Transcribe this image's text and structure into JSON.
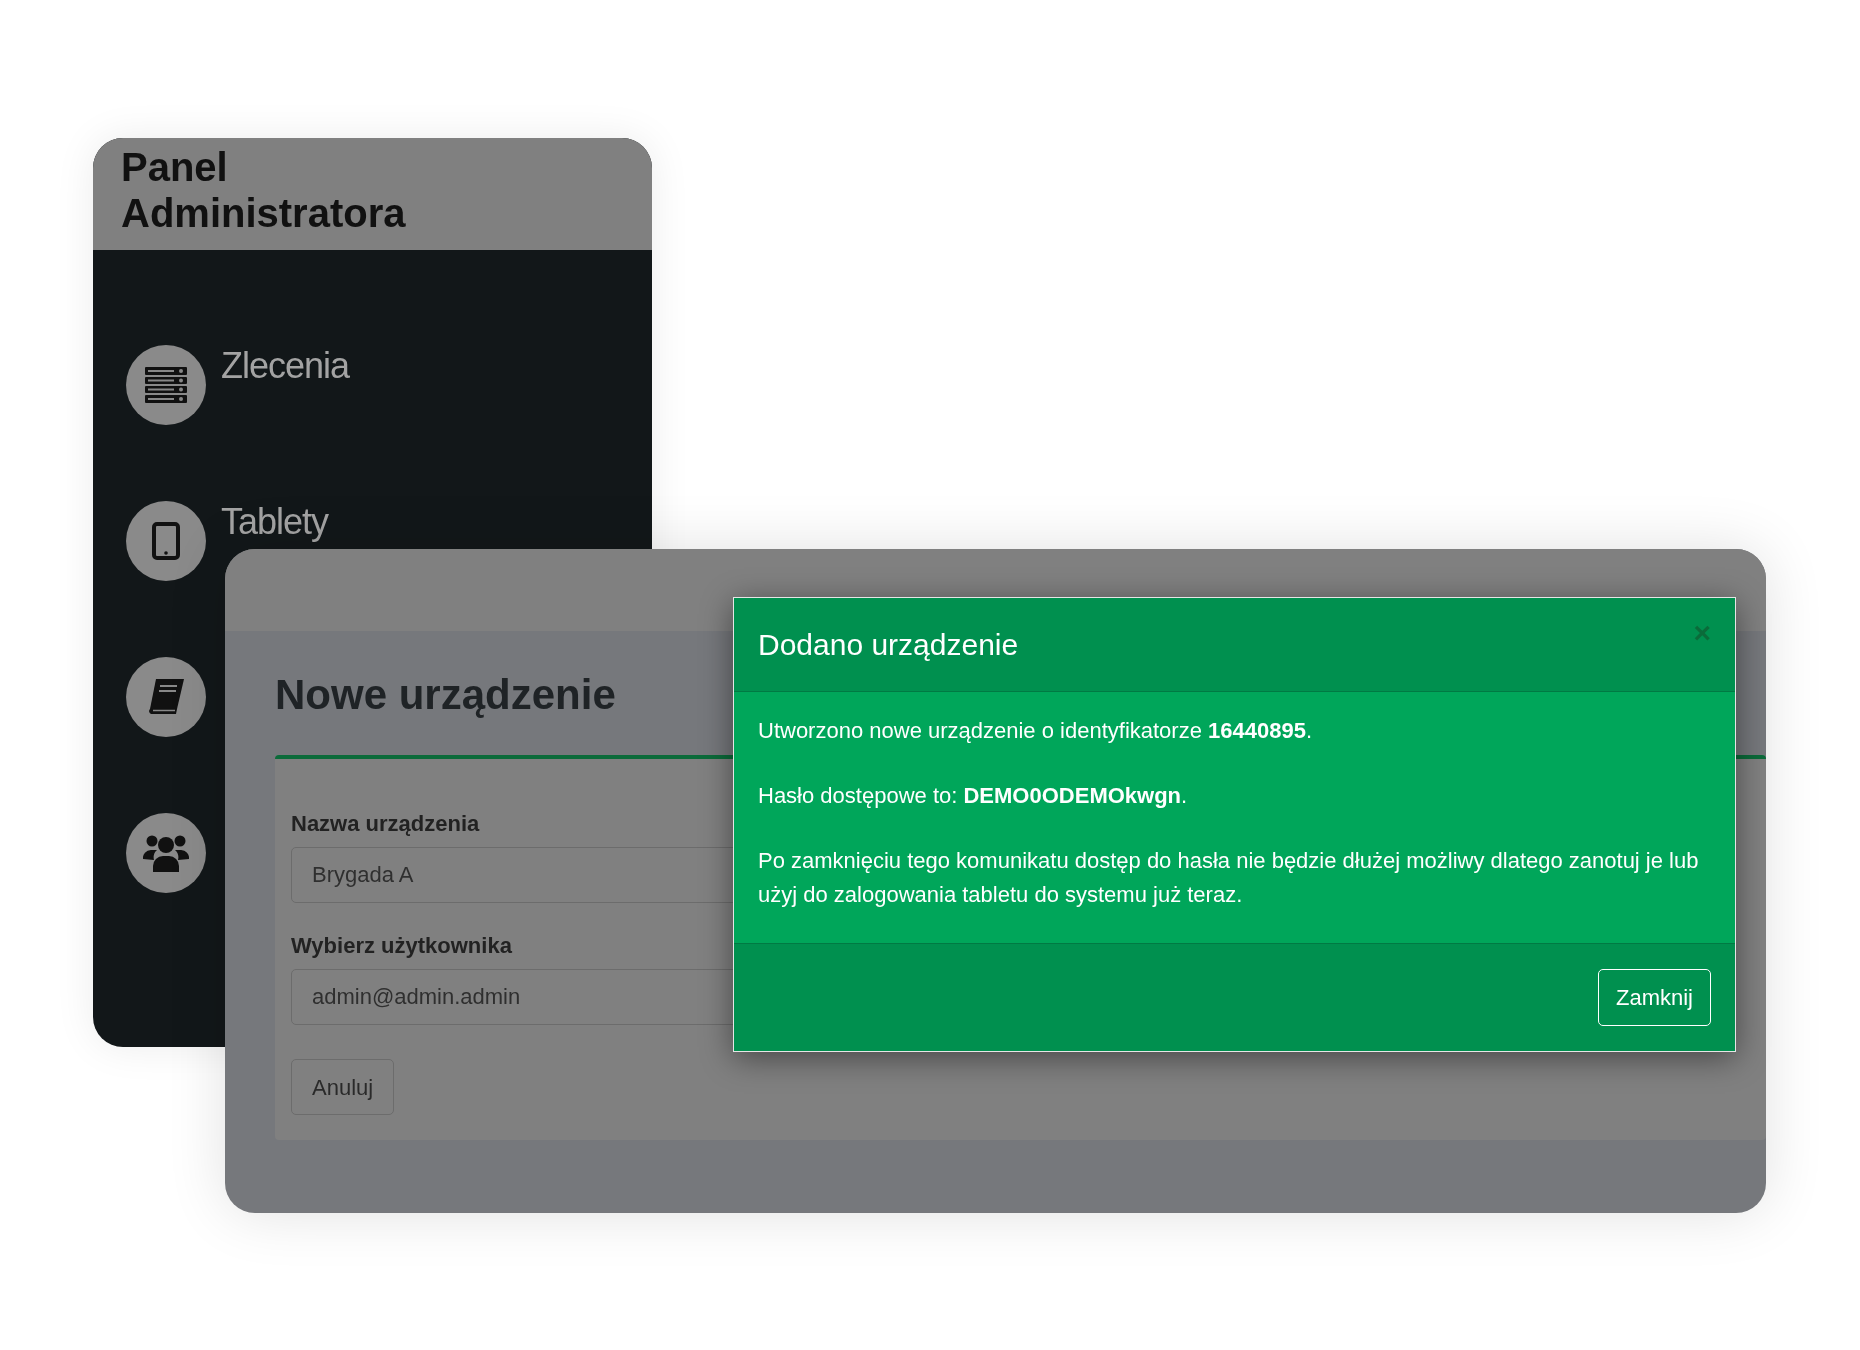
{
  "sidebar": {
    "title": "Panel Administratora",
    "items": [
      {
        "kind": "labeled",
        "label": "Zlecenia"
      },
      {
        "kind": "labeled",
        "label": "Tablety"
      },
      {
        "kind": "icon"
      },
      {
        "kind": "icon"
      }
    ]
  },
  "form": {
    "heading": "Nowe urządzenie",
    "fields": [
      {
        "label": "Nazwa urządzenia",
        "value": "Brygada A"
      },
      {
        "label": "Wybierz użytkownika",
        "value": "admin@admin.admin"
      }
    ],
    "buttons": [
      "Anuluj"
    ]
  },
  "dialog": {
    "title": "Dodano urządzenie",
    "close": "×",
    "paragraphs": [
      "Utworzono nowe urządzenie o identyfikatorze **16440895**.",
      "Hasło dostępowe to: **DEMO0ODEMOkwgn**.",
      "Po zamknięciu tego komunikatu dostęp do hasła nie będzie dłużej możliwy dlatego zanotuj je lub użyj do zalogowania tabletu do systemu już teraz."
    ],
    "buttons": [
      "Zamknij"
    ]
  }
}
